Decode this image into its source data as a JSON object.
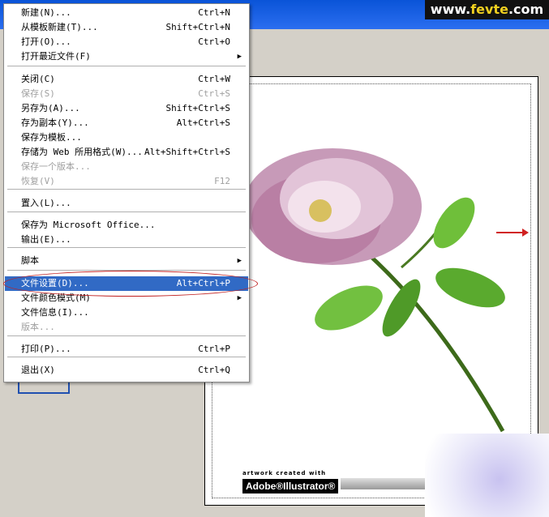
{
  "watermark": {
    "prefix": "www.",
    "brand": "fevte",
    "suffix": ".com"
  },
  "menu": {
    "items": [
      {
        "label": "新建(N)...",
        "shortcut": "Ctrl+N",
        "disabled": false,
        "submenu": false
      },
      {
        "label": "从模板新建(T)...",
        "shortcut": "Shift+Ctrl+N",
        "disabled": false,
        "submenu": false
      },
      {
        "label": "打开(O)...",
        "shortcut": "Ctrl+O",
        "disabled": false,
        "submenu": false
      },
      {
        "label": "打开最近文件(F)",
        "shortcut": "",
        "disabled": false,
        "submenu": true
      },
      {
        "label": "关闭(C)",
        "shortcut": "Ctrl+W",
        "disabled": false,
        "submenu": false
      },
      {
        "label": "保存(S)",
        "shortcut": "Ctrl+S",
        "disabled": true,
        "submenu": false
      },
      {
        "label": "另存为(A)...",
        "shortcut": "Shift+Ctrl+S",
        "disabled": false,
        "submenu": false
      },
      {
        "label": "存为副本(Y)...",
        "shortcut": "Alt+Ctrl+S",
        "disabled": false,
        "submenu": false
      },
      {
        "label": "保存为模板...",
        "shortcut": "",
        "disabled": false,
        "submenu": false
      },
      {
        "label": "存储为 Web 所用格式(W)...",
        "shortcut": "Alt+Shift+Ctrl+S",
        "disabled": false,
        "submenu": false
      },
      {
        "label": "保存一个版本...",
        "shortcut": "",
        "disabled": true,
        "submenu": false
      },
      {
        "label": "恢复(V)",
        "shortcut": "F12",
        "disabled": true,
        "submenu": false
      },
      {
        "label": "置入(L)...",
        "shortcut": "",
        "disabled": false,
        "submenu": false
      },
      {
        "label": "保存为 Microsoft Office...",
        "shortcut": "",
        "disabled": false,
        "submenu": false
      },
      {
        "label": "输出(E)...",
        "shortcut": "",
        "disabled": false,
        "submenu": false
      },
      {
        "label": "脚本",
        "shortcut": "",
        "disabled": false,
        "submenu": true
      },
      {
        "label": "文件设置(D)...",
        "shortcut": "Alt+Ctrl+P",
        "disabled": false,
        "submenu": false,
        "highlighted": true
      },
      {
        "label": "文件颜色模式(M)",
        "shortcut": "",
        "disabled": false,
        "submenu": true
      },
      {
        "label": "文件信息(I)...",
        "shortcut": "",
        "disabled": false,
        "submenu": false
      },
      {
        "label": "版本...",
        "shortcut": "",
        "disabled": true,
        "submenu": false
      },
      {
        "label": "打印(P)...",
        "shortcut": "Ctrl+P",
        "disabled": false,
        "submenu": false
      },
      {
        "label": "退出(X)",
        "shortcut": "Ctrl+Q",
        "disabled": false,
        "submenu": false
      }
    ],
    "submenu_glyph": "▶"
  },
  "artwork_credit": {
    "line1": "artwork created with",
    "badge": "Adobe®Illustrator®"
  },
  "colors": {
    "highlight": "#316ac5",
    "annotation_red": "#c02020",
    "disabled_text": "#a0a0a0"
  }
}
